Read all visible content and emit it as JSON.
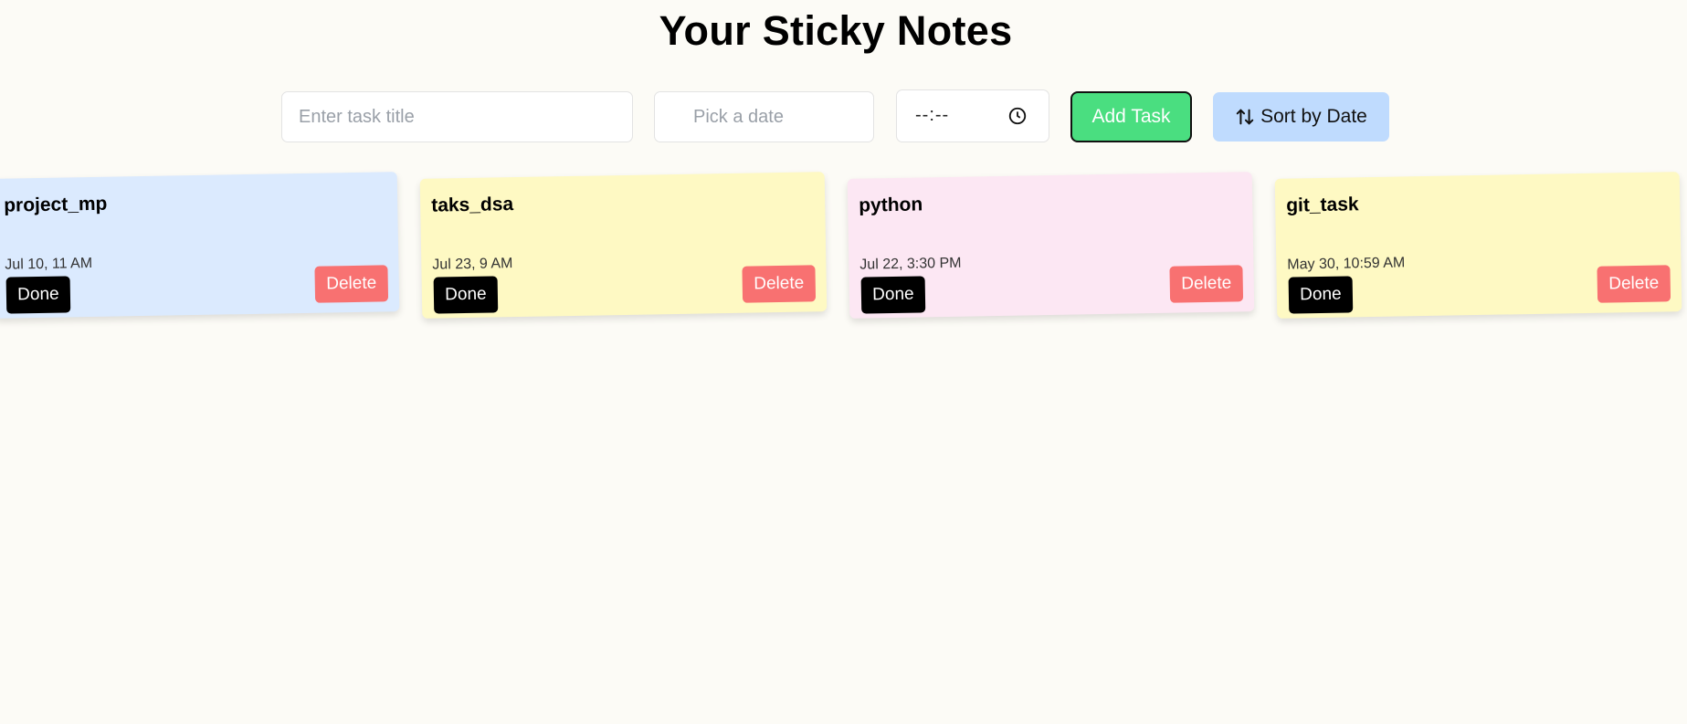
{
  "header": {
    "title": "Your Sticky Notes"
  },
  "form": {
    "title_placeholder": "Enter task title",
    "title_value": "",
    "date_placeholder": "Pick a date",
    "date_value": "",
    "time_display": "--:--",
    "clock_icon": "clock-icon",
    "add_label": "Add Task",
    "sort_label": "Sort by Date",
    "sort_icon": "sort-arrows-icon"
  },
  "notes": [
    {
      "title": "project_mp",
      "date": "Jul 10, 11 AM",
      "done_label": "Done",
      "delete_label": "Delete",
      "color": "#dbeafe"
    },
    {
      "title": "taks_dsa",
      "date": "Jul 23, 9 AM",
      "done_label": "Done",
      "delete_label": "Delete",
      "color": "#fef9c3"
    },
    {
      "title": "python",
      "date": "Jul 22, 3:30 PM",
      "done_label": "Done",
      "delete_label": "Delete",
      "color": "#fce7f3"
    },
    {
      "title": "git_task",
      "date": "May 30, 10:59 AM",
      "done_label": "Done",
      "delete_label": "Delete",
      "color": "#fef9c3"
    }
  ],
  "colors": {
    "background": "#fcfbf6",
    "add_button": "#4ade80",
    "sort_button": "#bfdbfe",
    "done_button": "#000000",
    "delete_button": "#f87171"
  }
}
